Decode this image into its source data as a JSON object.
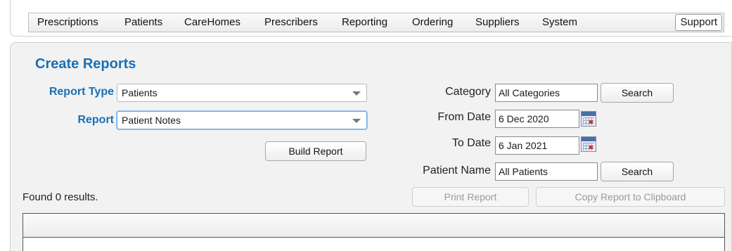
{
  "menu": {
    "items": [
      "Prescriptions",
      "Patients",
      "CareHomes",
      "Prescribers",
      "Reporting",
      "Ordering",
      "Suppliers",
      "System"
    ],
    "support_label": "Support"
  },
  "page": {
    "title": "Create Reports"
  },
  "form": {
    "report_type_label": "Report Type",
    "report_type_value": "Patients",
    "report_label": "Report",
    "report_value": "Patient Notes",
    "build_report_label": "Build Report",
    "category_label": "Category",
    "category_value": "All Categories",
    "category_search_label": "Search",
    "from_date_label": "From Date",
    "from_date_value": "6 Dec 2020",
    "to_date_label": "To Date",
    "to_date_value": "6 Jan 2021",
    "patient_name_label": "Patient Name",
    "patient_name_value": "All Patients",
    "patient_search_label": "Search"
  },
  "results": {
    "found_text": "Found 0 results.",
    "print_label": "Print Report",
    "copy_label": "Copy Report to Clipboard"
  },
  "colors": {
    "accent": "#1a6fb5",
    "calendar_mark": "#d93030"
  },
  "icons": {
    "date_picker": "calendar-icon",
    "dropdown": "chevron-down-icon"
  }
}
